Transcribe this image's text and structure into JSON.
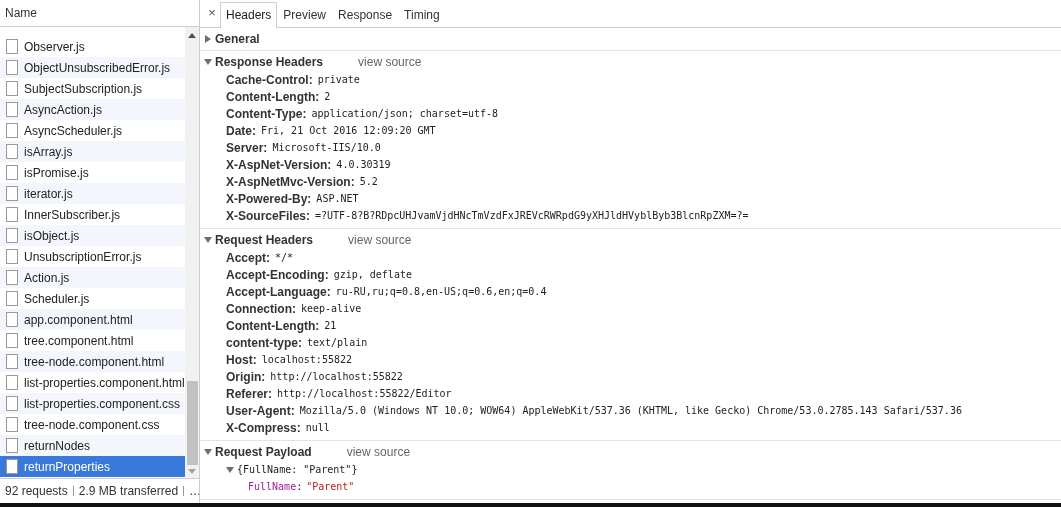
{
  "file_list": {
    "column_header": "Name",
    "items": [
      {
        "name": "Observer.js",
        "selected": false
      },
      {
        "name": "ObjectUnsubscribedError.js",
        "selected": false
      },
      {
        "name": "SubjectSubscription.js",
        "selected": false
      },
      {
        "name": "AsyncAction.js",
        "selected": false
      },
      {
        "name": "AsyncScheduler.js",
        "selected": false
      },
      {
        "name": "isArray.js",
        "selected": false
      },
      {
        "name": "isPromise.js",
        "selected": false
      },
      {
        "name": "iterator.js",
        "selected": false
      },
      {
        "name": "InnerSubscriber.js",
        "selected": false
      },
      {
        "name": "isObject.js",
        "selected": false
      },
      {
        "name": "UnsubscriptionError.js",
        "selected": false
      },
      {
        "name": "Action.js",
        "selected": false
      },
      {
        "name": "Scheduler.js",
        "selected": false
      },
      {
        "name": "app.component.html",
        "selected": false
      },
      {
        "name": "tree.component.html",
        "selected": false
      },
      {
        "name": "tree-node.component.html",
        "selected": false
      },
      {
        "name": "list-properties.component.html",
        "selected": false
      },
      {
        "name": "list-properties.component.css",
        "selected": false
      },
      {
        "name": "tree-node.component.css",
        "selected": false
      },
      {
        "name": "returnNodes",
        "selected": false
      },
      {
        "name": "returnProperties",
        "selected": true
      }
    ]
  },
  "status_bar": [
    "92 requests",
    "2.9 MB transferred",
    "…"
  ],
  "close": "×",
  "tabs": [
    {
      "label": "Headers",
      "selected": true
    },
    {
      "label": "Preview",
      "selected": false
    },
    {
      "label": "Response",
      "selected": false
    },
    {
      "label": "Timing",
      "selected": false
    }
  ],
  "sections": [
    {
      "title": "General",
      "expanded": false
    },
    {
      "title": "Response Headers",
      "expanded": true,
      "kind": "headers",
      "link": "view source",
      "headers": [
        {
          "name": "Cache-Control:",
          "value": "private"
        },
        {
          "name": "Content-Length:",
          "value": "2"
        },
        {
          "name": "Content-Type:",
          "value": "application/json; charset=utf-8"
        },
        {
          "name": "Date:",
          "value": "Fri, 21 Oct 2016 12:09:20 GMT"
        },
        {
          "name": "Server:",
          "value": "Microsoft-IIS/10.0"
        },
        {
          "name": "X-AspNet-Version:",
          "value": "4.0.30319"
        },
        {
          "name": "X-AspNetMvc-Version:",
          "value": "5.2"
        },
        {
          "name": "X-Powered-By:",
          "value": "ASP.NET"
        },
        {
          "name": "X-SourceFiles:",
          "value": "=?UTF-8?B?RDpcUHJvamVjdHNcTmVzdFxJREVcRWRpdG9yXHJldHVyblByb3BlcnRpZXM=?="
        }
      ]
    },
    {
      "title": "Request Headers",
      "expanded": true,
      "kind": "headers",
      "link": "view source",
      "headers": [
        {
          "name": "Accept:",
          "value": "*/*"
        },
        {
          "name": "Accept-Encoding:",
          "value": "gzip, deflate"
        },
        {
          "name": "Accept-Language:",
          "value": "ru-RU,ru;q=0.8,en-US;q=0.6,en;q=0.4"
        },
        {
          "name": "Connection:",
          "value": "keep-alive"
        },
        {
          "name": "Content-Length:",
          "value": "21"
        },
        {
          "name": "content-type:",
          "value": "text/plain"
        },
        {
          "name": "Host:",
          "value": "localhost:55822"
        },
        {
          "name": "Origin:",
          "value": "http://localhost:55822"
        },
        {
          "name": "Referer:",
          "value": "http://localhost:55822/Editor"
        },
        {
          "name": "User-Agent:",
          "value": "Mozilla/5.0 (Windows NT 10.0; WOW64) AppleWebKit/537.36 (KHTML, like Gecko) Chrome/53.0.2785.143 Safari/537.36"
        },
        {
          "name": "X-Compress:",
          "value": "null"
        }
      ]
    },
    {
      "title": "Request Payload",
      "expanded": true,
      "kind": "payload",
      "link": "view source",
      "payload": {
        "summary": "{FullName: \"Parent\"}",
        "expanded": true,
        "properties": [
          {
            "key": "FullName",
            "sep": ":",
            "value": "\"Parent\""
          }
        ]
      }
    }
  ]
}
